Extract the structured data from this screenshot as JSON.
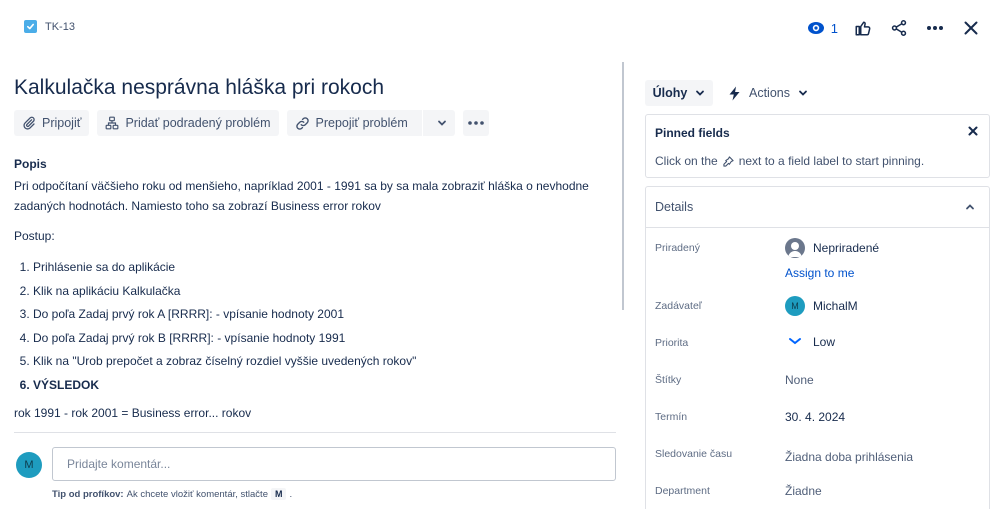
{
  "issue": {
    "key": "TK-13",
    "title": "Kalkulačka nesprávna hláška pri rokoch"
  },
  "top_actions": {
    "watch_count": "1"
  },
  "toolbar": {
    "attach": "Pripojiť",
    "add_child": "Pridať podradený problém",
    "link_issue": "Prepojiť problém"
  },
  "description": {
    "heading": "Popis",
    "para1": "Pri odpočítaní väčšieho roku od menšieho, napríklad 2001 - 1991 sa by sa mala zobraziť hláška o nevhodne zadaných hodnotách. Namiesto toho sa zobrazí Business error rokov",
    "postup": "Postup:",
    "steps": [
      "Prihlásenie sa do aplikácie",
      "Klik na aplikáciu Kalkulačka",
      "Do poľa Zadaj prvý rok A [RRRR]: - vpísanie hodnoty 2001",
      "Do poľa Zadaj prvý rok B [RRRR]: - vpísanie hodnoty 1991",
      "Klik na \"Urob prepočet a zobraz číselný rozdiel vyššie uvedených rokov\"",
      "VÝSLEDOK"
    ],
    "result": "rok 1991 - rok 2001 = Business error... rokov"
  },
  "comment": {
    "avatar_initial": "M",
    "placeholder": "Pridajte komentár...",
    "tip_bold": "Tip od profíkov:",
    "tip_text": "Ak chcete vložiť komentár, stlačte",
    "tip_key": "M",
    "tip_end": "."
  },
  "sidebar": {
    "status_label": "Úlohy",
    "actions_label": "Actions",
    "pinned": {
      "title": "Pinned fields",
      "text_before": "Click on the",
      "text_after": "next to a field label to start pinning."
    },
    "details": {
      "title": "Details",
      "fields": {
        "assignee_label": "Priradený",
        "assignee_value": "Nepriradené",
        "assign_me": "Assign to me",
        "reporter_label": "Zadávateľ",
        "reporter_initial": "M",
        "reporter_value": "MichalM",
        "priority_label": "Priorita",
        "priority_value": "Low",
        "labels_label": "Štítky",
        "labels_value": "None",
        "due_label": "Termín",
        "due_value": "30. 4. 2024",
        "time_label": "Sledovanie času",
        "time_value": "Žiadna doba prihlásenia",
        "department_label": "Department",
        "department_value": "Žiadne"
      }
    }
  },
  "colors": {
    "accent": "#0052cc",
    "avatar": "#1e9cbf",
    "priority_low": "#0065ff"
  }
}
